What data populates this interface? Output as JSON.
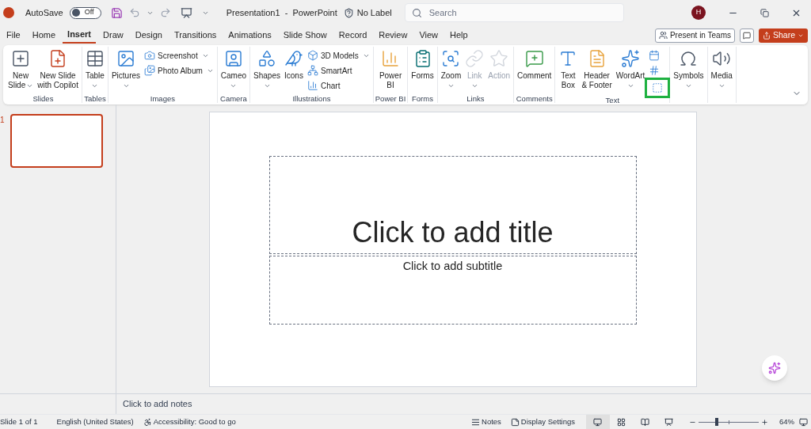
{
  "title_bar": {
    "autosave_label": "AutoSave",
    "autosave": {
      "label": "Off",
      "on": false
    },
    "document_title": "Presentation1  -  PowerPoint",
    "sensitivity": "No Label",
    "search": {
      "placeholder": "Search"
    },
    "avatar": "H"
  },
  "tabs": [
    {
      "label": "File",
      "selected": false
    },
    {
      "label": "Home",
      "selected": false
    },
    {
      "label": "Insert",
      "selected": true
    },
    {
      "label": "Draw",
      "selected": false
    },
    {
      "label": "Design",
      "selected": false
    },
    {
      "label": "Transitions",
      "selected": false
    },
    {
      "label": "Animations",
      "selected": false
    },
    {
      "label": "Slide Show",
      "selected": false
    },
    {
      "label": "Record",
      "selected": false
    },
    {
      "label": "Review",
      "selected": false
    },
    {
      "label": "View",
      "selected": false
    },
    {
      "label": "Help",
      "selected": false
    }
  ],
  "actions": {
    "present": "Present in Teams",
    "share": "Share"
  },
  "ribbon": {
    "groups": [
      {
        "label": "Slides",
        "items": [
          {
            "kind": "large",
            "lines": [
              "New",
              "Slide"
            ],
            "dropdown": true,
            "disabled": false
          },
          {
            "kind": "large",
            "lines": [
              "New Slide",
              "with Copilot"
            ],
            "dropdown": false,
            "disabled": false
          }
        ]
      },
      {
        "label": "Tables",
        "items": [
          {
            "kind": "large",
            "lines": [
              "Table"
            ],
            "dropdown": true,
            "disabled": false
          }
        ]
      },
      {
        "label": "Images",
        "items": [
          {
            "kind": "large",
            "lines": [
              "Pictures"
            ],
            "dropdown": true,
            "disabled": false
          },
          {
            "kind": "stack",
            "items": [
              {
                "label": "Screenshot",
                "dropdown": true,
                "highlighted": false
              },
              {
                "label": "Photo Album",
                "dropdown": true,
                "highlighted": false
              }
            ]
          }
        ]
      },
      {
        "label": "Camera",
        "items": [
          {
            "kind": "large",
            "lines": [
              "Cameo"
            ],
            "dropdown": true,
            "disabled": false
          }
        ]
      },
      {
        "label": "Illustrations",
        "items": [
          {
            "kind": "large",
            "lines": [
              "Shapes"
            ],
            "dropdown": true,
            "disabled": false
          },
          {
            "kind": "large",
            "lines": [
              "Icons"
            ],
            "dropdown": false,
            "disabled": false
          },
          {
            "kind": "stack",
            "items": [
              {
                "label": "3D Models",
                "dropdown": true,
                "highlighted": false
              },
              {
                "label": "SmartArt",
                "dropdown": false,
                "highlighted": false
              },
              {
                "label": "Chart",
                "dropdown": false,
                "highlighted": false
              }
            ]
          }
        ]
      },
      {
        "label": "Power BI",
        "items": [
          {
            "kind": "large",
            "lines": [
              "Power",
              "BI"
            ],
            "dropdown": false,
            "disabled": false
          }
        ]
      },
      {
        "label": "Forms",
        "items": [
          {
            "kind": "large",
            "lines": [
              "Forms"
            ],
            "dropdown": false,
            "disabled": false
          }
        ]
      },
      {
        "label": "Links",
        "items": [
          {
            "kind": "large",
            "lines": [
              "Zoom"
            ],
            "dropdown": true,
            "disabled": false
          },
          {
            "kind": "large",
            "lines": [
              "Link"
            ],
            "dropdown": true,
            "disabled": true
          },
          {
            "kind": "large",
            "lines": [
              "Action"
            ],
            "dropdown": false,
            "disabled": true
          }
        ]
      },
      {
        "label": "Comments",
        "items": [
          {
            "kind": "large",
            "lines": [
              "Comment"
            ],
            "dropdown": false,
            "disabled": false
          }
        ]
      },
      {
        "label": "Text",
        "items": [
          {
            "kind": "large",
            "lines": [
              "Text",
              "Box"
            ],
            "dropdown": false,
            "disabled": false
          },
          {
            "kind": "large",
            "lines": [
              "Header",
              "& Footer"
            ],
            "dropdown": false,
            "disabled": false
          },
          {
            "kind": "large",
            "lines": [
              "WordArt"
            ],
            "dropdown": true,
            "disabled": false
          },
          {
            "kind": "stack",
            "items": [
              {
                "dropdown": false,
                "highlighted": false
              },
              {
                "dropdown": false,
                "highlighted": false
              },
              {
                "dropdown": false,
                "highlighted": true
              }
            ]
          }
        ]
      },
      {
        "items": [
          {
            "kind": "large",
            "lines": [
              "Symbols"
            ],
            "dropdown": true,
            "disabled": false
          }
        ]
      },
      {
        "items": [
          {
            "kind": "large",
            "lines": [
              "Media"
            ],
            "dropdown": true,
            "disabled": false
          }
        ]
      }
    ]
  },
  "thumbnails": [
    {
      "number": "1",
      "selected": true
    }
  ],
  "slide": {
    "title": "Click to add title",
    "subtitle": "Click to add subtitle"
  },
  "notes_placeholder": "Click to add notes",
  "status_bar": {
    "slide": "Slide 1 of 1",
    "language": "English (United States)",
    "accessibility": "Accessibility: Good to go",
    "notes": "Notes",
    "display_settings": "Display Settings",
    "views": [
      {
        "selected": true
      },
      {
        "selected": false
      },
      {
        "selected": false
      },
      {
        "selected": false
      }
    ],
    "zoom": {
      "level": 0.3,
      "reading": "64%"
    }
  }
}
